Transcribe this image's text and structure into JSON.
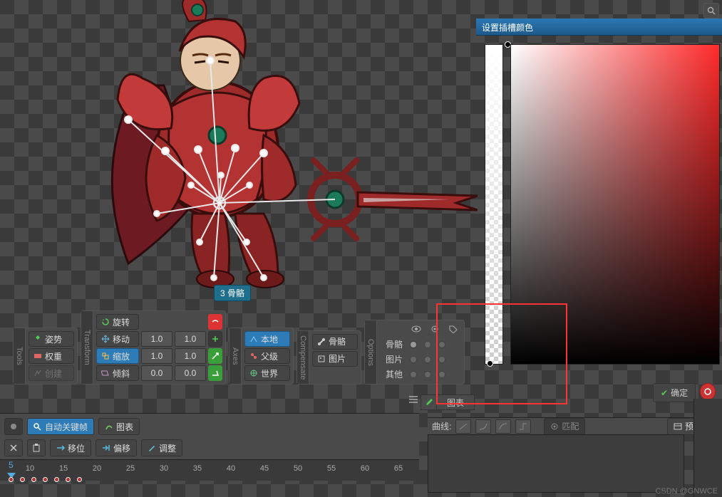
{
  "viewport": {
    "bone_label": "3 骨骼"
  },
  "tools": {
    "tab": "Tools",
    "pose": "姿势",
    "weight": "权重",
    "create": "创建"
  },
  "transform": {
    "tab": "Transform",
    "rotate": "旋转",
    "move": "移动",
    "scale": "缩放",
    "shear": "倾斜",
    "move_vals": [
      "1.0",
      "1.0"
    ],
    "scale_vals": [
      "1.0",
      "1.0"
    ],
    "shear_vals": [
      "0.0",
      "0.0"
    ]
  },
  "axes": {
    "tab": "Axes",
    "local": "本地",
    "parent": "父级",
    "world": "世界"
  },
  "compensate": {
    "tab": "Compensate",
    "bones": "骨骼",
    "images": "图片"
  },
  "options": {
    "tab": "Options",
    "rows": [
      "骨骼",
      "图片",
      "其他"
    ]
  },
  "timeline": {
    "chart_btn": "图表",
    "auto_key": "自动关键帧",
    "graph": "图表",
    "shift": "移位",
    "offset": "偏移",
    "adjust": "调整",
    "ruler_start": 5,
    "ruler_ticks": [
      "10",
      "15",
      "20",
      "25",
      "30",
      "35",
      "40",
      "45",
      "50",
      "55",
      "60",
      "65"
    ]
  },
  "color_panel": {
    "title": "设置插槽颜色",
    "ok": "确定"
  },
  "curve": {
    "label": "曲线:",
    "match": "匹配",
    "preset": "预设"
  },
  "watermark": "CSDN @GNWCE"
}
